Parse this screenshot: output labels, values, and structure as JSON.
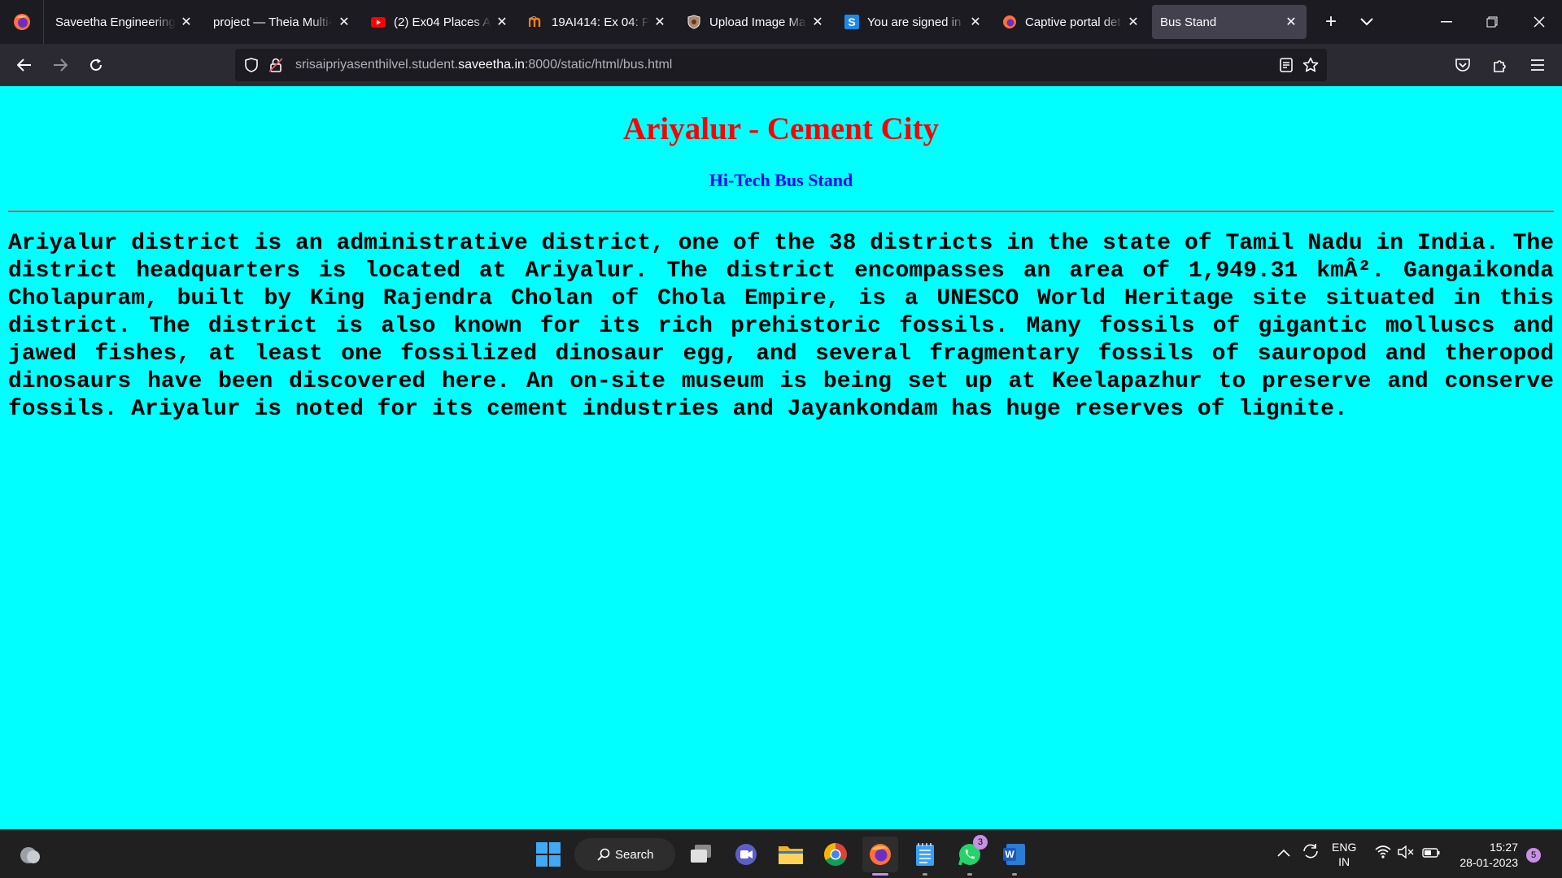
{
  "browser": {
    "tabs": [
      {
        "title": "Saveetha Engineering",
        "icon": "saveetha-favicon"
      },
      {
        "title": "project — Theia Multi-",
        "icon": "theia-favicon"
      },
      {
        "title": "(2) Ex04 Places Ar",
        "icon": "youtube-favicon"
      },
      {
        "title": "19AI414: Ex 04: Pla",
        "icon": "moodle-favicon"
      },
      {
        "title": "Upload Image Ma",
        "icon": "shield-favicon"
      },
      {
        "title": "You are signed in",
        "icon": "s-favicon"
      },
      {
        "title": "Captive portal det",
        "icon": "firefox-favicon"
      },
      {
        "title": "Bus Stand",
        "icon": "none",
        "active": true
      }
    ],
    "url": {
      "prefix": "srisaipriyasenthilvel.student.",
      "domain": "saveetha.in",
      "suffix": ":8000/static/html/bus.html"
    }
  },
  "page": {
    "title": "Ariyalur - Cement City",
    "subtitle": "Hi-Tech Bus Stand",
    "body": "Ariyalur district is an administrative district, one of the 38 districts in the state of Tamil Nadu in India. The district headquarters is located at Ariyalur. The district encompasses an area of 1,949.31 kmÂ². Gangaikonda Cholapuram, built by King Rajendra Cholan of Chola Empire, is a UNESCO World Heritage site situated in this district. The district is also known for its rich prehistoric fossils. Many fossils of gigantic molluscs and jawed fishes, at least one fossilized dinosaur egg, and several fragmentary fossils of sauropod and theropod dinosaurs have been discovered here. An on-site museum is being set up at Keelapazhur to preserve and conserve fossils. Ariyalur is noted for its cement industries and Jayankondam has huge reserves of lignite.",
    "colors": {
      "background": "#00ffff",
      "title": "#ff0000",
      "subtitle": "#0000ff",
      "rule": "#ff4d4d"
    }
  },
  "taskbar": {
    "search_label": "Search",
    "whatsapp_badge": "3",
    "lang_top": "ENG",
    "lang_bottom": "IN",
    "time": "15:27",
    "date": "28-01-2023",
    "notification_count": "5"
  }
}
